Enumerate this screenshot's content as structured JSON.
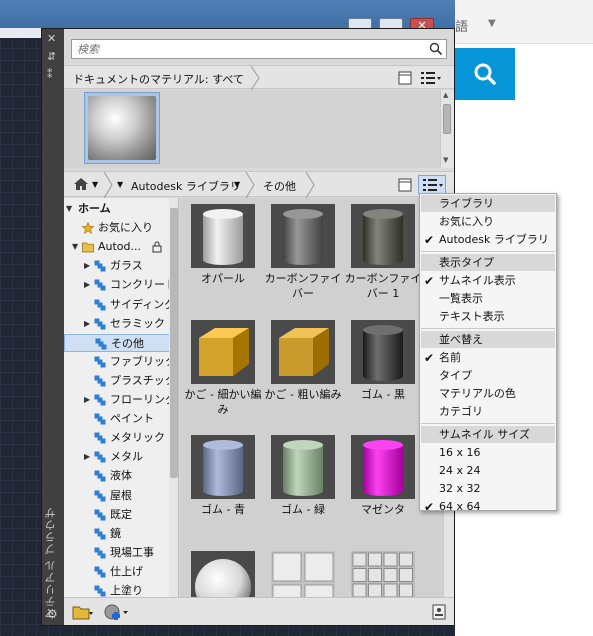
{
  "web": {
    "lang_label": "語"
  },
  "palette": {
    "side_title": "マテリアル ブラウザ",
    "close_glyph": "✕",
    "search": {
      "placeholder": "検索"
    },
    "doc_crumb": "ドキュメントのマテリアル: すべて",
    "doc_materials": [
      "sphere-material"
    ],
    "lib_crumbs": {
      "library": "Autodesk ライブラリ",
      "current": "その他"
    },
    "tree": [
      {
        "label": "ホーム",
        "level": 0,
        "icon": "none",
        "expander": "open"
      },
      {
        "label": "お気に入り",
        "level": 1,
        "icon": "star",
        "expander": "none"
      },
      {
        "label": "Autod...",
        "level": 1,
        "icon": "folder-lock",
        "expander": "open"
      },
      {
        "label": "ガラス",
        "level": 2,
        "icon": "category",
        "expander": "closed"
      },
      {
        "label": "コンクリート",
        "level": 2,
        "icon": "category",
        "expander": "closed"
      },
      {
        "label": "サイディング",
        "level": 2,
        "icon": "category",
        "expander": "none"
      },
      {
        "label": "セラミック",
        "level": 2,
        "icon": "category",
        "expander": "closed"
      },
      {
        "label": "その他",
        "level": 2,
        "icon": "category",
        "expander": "none",
        "selected": true
      },
      {
        "label": "ファブリック",
        "level": 2,
        "icon": "category",
        "expander": "none"
      },
      {
        "label": "プラスチック",
        "level": 2,
        "icon": "category",
        "expander": "none"
      },
      {
        "label": "フローリング",
        "level": 2,
        "icon": "category",
        "expander": "closed"
      },
      {
        "label": "ペイント",
        "level": 2,
        "icon": "category",
        "expander": "none"
      },
      {
        "label": "メタリック ...",
        "level": 2,
        "icon": "category",
        "expander": "none"
      },
      {
        "label": "メタル",
        "level": 2,
        "icon": "category",
        "expander": "closed"
      },
      {
        "label": "液体",
        "level": 2,
        "icon": "category",
        "expander": "none"
      },
      {
        "label": "屋根",
        "level": 2,
        "icon": "category",
        "expander": "none"
      },
      {
        "label": "既定",
        "level": 2,
        "icon": "category",
        "expander": "none"
      },
      {
        "label": "鏡",
        "level": 2,
        "icon": "category",
        "expander": "none"
      },
      {
        "label": "現場工事",
        "level": 2,
        "icon": "category",
        "expander": "none"
      },
      {
        "label": "仕上げ",
        "level": 2,
        "icon": "category",
        "expander": "none"
      },
      {
        "label": "上塗り",
        "level": 2,
        "icon": "category",
        "expander": "none"
      }
    ],
    "materials": [
      {
        "label": "オパール",
        "shape": "cylinder",
        "color": "#c9c9c9"
      },
      {
        "label": "カーボンファイバー",
        "shape": "cylinder",
        "color": "#6f6f6f"
      },
      {
        "label": "カーボンファイバー 1",
        "shape": "cylinder",
        "color": "#5b5d55"
      },
      {
        "label": "かご - 細かい編み",
        "shape": "cube",
        "color": "#d3a22a"
      },
      {
        "label": "かご - 粗い編み",
        "shape": "cube",
        "color": "#c99a2c"
      },
      {
        "label": "ゴム - 黒",
        "shape": "cylinder",
        "color": "#474747"
      },
      {
        "label": "ゴム - 青",
        "shape": "cylinder",
        "color": "#8892b3"
      },
      {
        "label": "ゴム - 緑",
        "shape": "cylinder",
        "color": "#97ad94"
      },
      {
        "label": "マゼンタ",
        "shape": "cylinder",
        "color": "#d21bc9"
      },
      {
        "label": "",
        "shape": "sphere",
        "color": "#d8d8d8"
      },
      {
        "label": "",
        "shape": "tile",
        "color": "#c4c4c4"
      },
      {
        "label": "",
        "shape": "tile-pattern",
        "color": "#bdbdbd"
      }
    ]
  },
  "menu": {
    "sections": [
      {
        "header": "ライブラリ",
        "items": [
          {
            "label": "お気に入り",
            "checked": false
          },
          {
            "label": "Autodesk ライブラリ",
            "checked": true
          }
        ]
      },
      {
        "header": "表示タイプ",
        "items": [
          {
            "label": "サムネイル表示",
            "checked": true
          },
          {
            "label": "一覧表示",
            "checked": false
          },
          {
            "label": "テキスト表示",
            "checked": false
          }
        ]
      },
      {
        "header": "並べ替え",
        "items": [
          {
            "label": "名前",
            "checked": true
          },
          {
            "label": "タイプ",
            "checked": false
          },
          {
            "label": "マテリアルの色",
            "checked": false
          },
          {
            "label": "カテゴリ",
            "checked": false
          }
        ]
      },
      {
        "header": "サムネイル サイズ",
        "items": [
          {
            "label": "16 x 16",
            "checked": false
          },
          {
            "label": "24 x 24",
            "checked": false
          },
          {
            "label": "32 x 32",
            "checked": false
          },
          {
            "label": "64 x 64",
            "checked": true
          }
        ]
      }
    ]
  }
}
